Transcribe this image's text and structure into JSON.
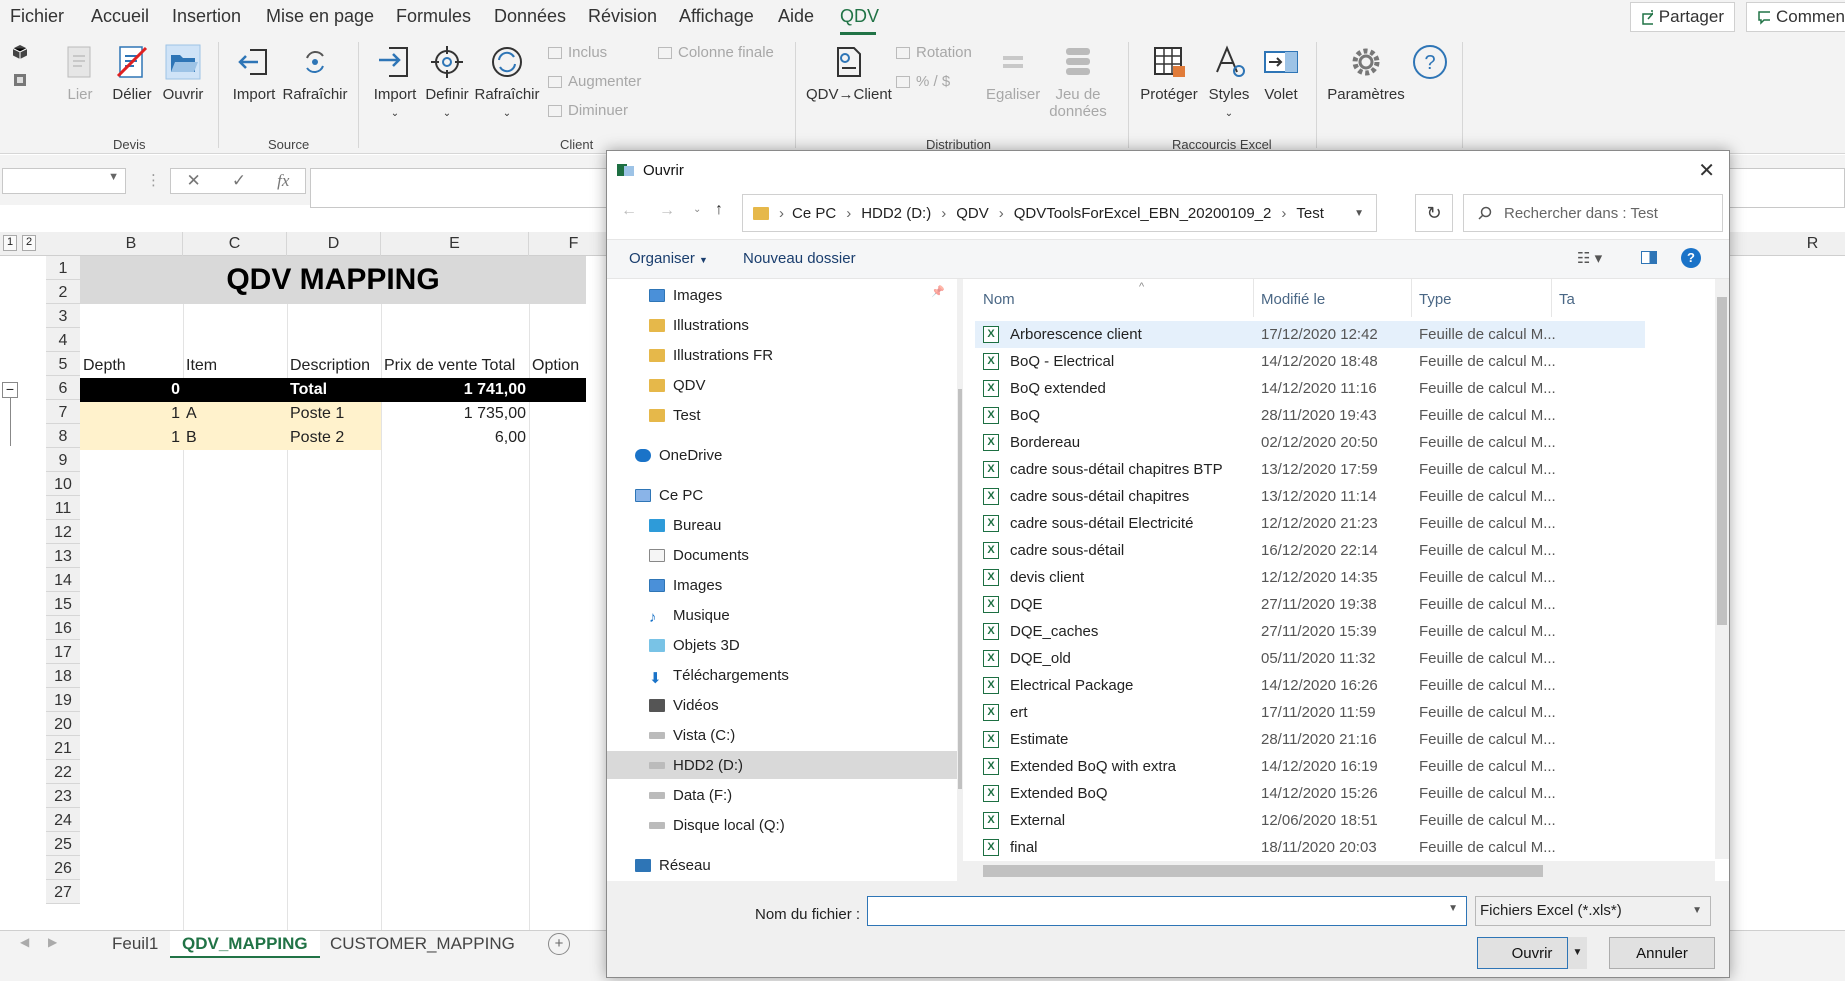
{
  "menu": {
    "items": [
      "Fichier",
      "Accueil",
      "Insertion",
      "Mise en page",
      "Formules",
      "Données",
      "Révision",
      "Affichage",
      "Aide",
      "QDV"
    ],
    "active": "QDV",
    "share": "Partager",
    "comments": "Commen"
  },
  "ribbon": {
    "devis": {
      "label": "Devis",
      "lier": "Lier",
      "delier": "Délier",
      "ouvrir": "Ouvrir"
    },
    "source": {
      "label": "Source",
      "import": "Import",
      "rafraichir": "Rafraîchir"
    },
    "client": {
      "label": "Client",
      "import": "Import",
      "definir": "Definir",
      "rafraichir": "Rafraîchir",
      "inclus": "Inclus",
      "augmenter": "Augmenter",
      "diminuer": "Diminuer",
      "colonne_finale": "Colonne finale"
    },
    "distribution": {
      "label": "Distribution",
      "qdv_client": "QDV→Client",
      "rotation": "Rotation",
      "percent": "% / $",
      "egaliser": "Egaliser",
      "jeu_line1": "Jeu de",
      "jeu_line2": "données"
    },
    "raccourcis": {
      "label": "Raccourcis Excel",
      "proteger": "Protéger",
      "styles": "Styles",
      "volet": "Volet"
    },
    "parametres": "Paramètres"
  },
  "formula": {
    "fx": "fx"
  },
  "sheet": {
    "columns": [
      "B",
      "C",
      "D",
      "E",
      "F",
      "R"
    ],
    "row_numbers": [
      "1",
      "2",
      "3",
      "4",
      "5",
      "6",
      "7",
      "8",
      "9",
      "10",
      "11",
      "12",
      "13",
      "14",
      "15",
      "16",
      "17",
      "18",
      "19",
      "20",
      "21",
      "22",
      "23",
      "24",
      "25",
      "26",
      "27"
    ],
    "title": "QDV MAPPING",
    "headers": [
      "Depth",
      "Item",
      "Description",
      "Prix de vente Total",
      "Option"
    ],
    "total_row": {
      "depth": "0",
      "desc": "Total",
      "price": "1 741,00"
    },
    "rows": [
      {
        "depth": "1",
        "item": "A",
        "desc": "Poste 1",
        "price": "1 735,00"
      },
      {
        "depth": "1",
        "item": "B",
        "desc": "Poste 2",
        "price": "6,00"
      }
    ],
    "outline_levels": [
      "1",
      "2"
    ],
    "tabs": [
      "Feuil1",
      "QDV_MAPPING",
      "CUSTOMER_MAPPING"
    ],
    "active_tab": "QDV_MAPPING"
  },
  "dialog": {
    "title": "Ouvrir",
    "path": [
      "Ce PC",
      "HDD2 (D:)",
      "QDV",
      "QDVToolsForExcel_EBN_20200109_2",
      "Test"
    ],
    "search_placeholder": "Rechercher dans : Test",
    "organize": "Organiser",
    "new_folder": "Nouveau dossier",
    "nav": [
      {
        "label": "Images",
        "icon": "images-icon"
      },
      {
        "label": "Illustrations",
        "icon": "folder-icon"
      },
      {
        "label": "Illustrations FR",
        "icon": "folder-icon"
      },
      {
        "label": "QDV",
        "icon": "folder-icon"
      },
      {
        "label": "Test",
        "icon": "folder-icon"
      },
      {
        "label": "OneDrive",
        "icon": "onedrive-icon"
      },
      {
        "label": "Ce PC",
        "icon": "computer-icon"
      },
      {
        "label": "Bureau",
        "icon": "desktop-icon"
      },
      {
        "label": "Documents",
        "icon": "documents-icon"
      },
      {
        "label": "Images",
        "icon": "images-icon"
      },
      {
        "label": "Musique",
        "icon": "music-icon"
      },
      {
        "label": "Objets 3D",
        "icon": "cube-icon"
      },
      {
        "label": "Téléchargements",
        "icon": "download-icon"
      },
      {
        "label": "Vidéos",
        "icon": "video-icon"
      },
      {
        "label": "Vista (C:)",
        "icon": "drive-icon"
      },
      {
        "label": "HDD2 (D:)",
        "icon": "drive-icon"
      },
      {
        "label": "Data (F:)",
        "icon": "drive-icon"
      },
      {
        "label": "Disque local (Q:)",
        "icon": "drive-icon"
      },
      {
        "label": "Réseau",
        "icon": "network-icon"
      }
    ],
    "nav_selected": "HDD2 (D:)",
    "columns": {
      "name": "Nom",
      "modified": "Modifié le",
      "type": "Type",
      "size": "Ta"
    },
    "files": [
      {
        "name": "Arborescence client",
        "date": "17/12/2020 12:42",
        "type": "Feuille de calcul M..."
      },
      {
        "name": "BoQ - Electrical",
        "date": "14/12/2020 18:48",
        "type": "Feuille de calcul M..."
      },
      {
        "name": "BoQ extended",
        "date": "14/12/2020 11:16",
        "type": "Feuille de calcul M..."
      },
      {
        "name": "BoQ",
        "date": "28/11/2020 19:43",
        "type": "Feuille de calcul M..."
      },
      {
        "name": "Bordereau",
        "date": "02/12/2020 20:50",
        "type": "Feuille de calcul M..."
      },
      {
        "name": "cadre sous-détail chapitres BTP",
        "date": "13/12/2020 17:59",
        "type": "Feuille de calcul M..."
      },
      {
        "name": "cadre sous-détail chapitres",
        "date": "13/12/2020 11:14",
        "type": "Feuille de calcul M..."
      },
      {
        "name": "cadre sous-détail Electricité",
        "date": "12/12/2020 21:23",
        "type": "Feuille de calcul M..."
      },
      {
        "name": "cadre sous-détail",
        "date": "16/12/2020 22:14",
        "type": "Feuille de calcul M..."
      },
      {
        "name": "devis client",
        "date": "12/12/2020 14:35",
        "type": "Feuille de calcul M..."
      },
      {
        "name": "DQE",
        "date": "27/11/2020 19:38",
        "type": "Feuille de calcul M..."
      },
      {
        "name": "DQE_caches",
        "date": "27/11/2020 15:39",
        "type": "Feuille de calcul M..."
      },
      {
        "name": "DQE_old",
        "date": "05/11/2020 11:32",
        "type": "Feuille de calcul M..."
      },
      {
        "name": "Electrical Package",
        "date": "14/12/2020 16:26",
        "type": "Feuille de calcul M..."
      },
      {
        "name": "ert",
        "date": "17/11/2020 11:59",
        "type": "Feuille de calcul M..."
      },
      {
        "name": "Estimate",
        "date": "28/11/2020 21:16",
        "type": "Feuille de calcul M..."
      },
      {
        "name": "Extended BoQ with extra",
        "date": "14/12/2020 16:19",
        "type": "Feuille de calcul M..."
      },
      {
        "name": "Extended BoQ",
        "date": "14/12/2020 15:26",
        "type": "Feuille de calcul M..."
      },
      {
        "name": "External",
        "date": "12/06/2020 18:51",
        "type": "Feuille de calcul M..."
      },
      {
        "name": "final",
        "date": "18/11/2020 20:03",
        "type": "Feuille de calcul M..."
      }
    ],
    "selected_file": "Arborescence client",
    "filename_label": "Nom du fichier :",
    "filename_value": "",
    "filter": "Fichiers Excel (*.xls*)",
    "open": "Ouvrir",
    "cancel": "Annuler"
  },
  "colors": {
    "excel_green": "#217346",
    "header_band": "#d9d9d9",
    "total_bg": "#000000",
    "row_bg": "#fff2cc",
    "selection": "#e5f0fb"
  }
}
